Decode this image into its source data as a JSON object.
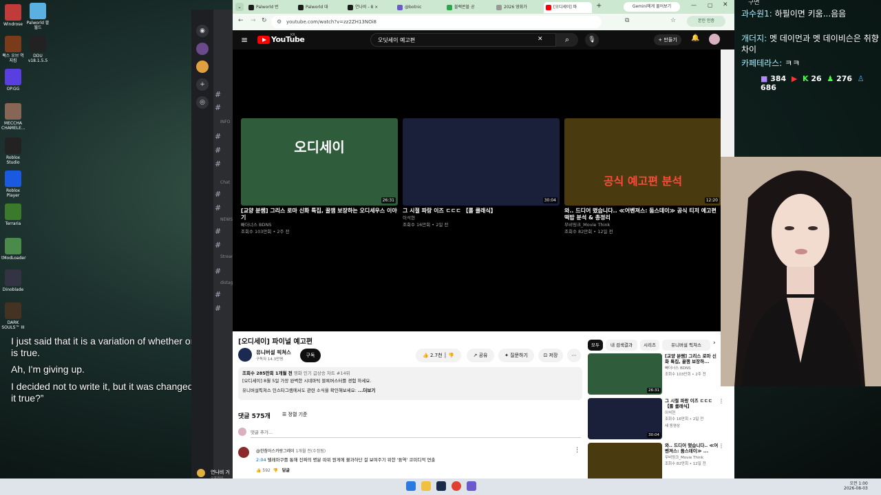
{
  "desktop": {
    "icons": [
      {
        "label": "Windrose",
        "color": "#c23b3b"
      },
      {
        "label": "Palworld 팔월드",
        "color": "#5ab0e0"
      },
      {
        "label": "팩스 오브 역지킴",
        "color": "#7a3b1a"
      },
      {
        "label": "DDU v18.1.5.5",
        "color": "#222"
      },
      {
        "label": "OP.GG",
        "color": "#5a3fe0"
      },
      {
        "label": "MECCHA CHAMELE...",
        "color": "#886655"
      },
      {
        "label": "Roblox Studio",
        "color": "#222"
      },
      {
        "label": "Roblox Player",
        "color": "#1a5ae0"
      },
      {
        "label": "Terraria",
        "color": "#3a7a2a"
      },
      {
        "label": "tModLoader",
        "color": "#4a8a4a"
      },
      {
        "label": "Dinoblade",
        "color": "#334"
      },
      {
        "label": "DARK SOULS™ III",
        "color": "#443322"
      }
    ]
  },
  "subtitles": [
    "I just said that it is a variation of whether or not it is true.",
    "Ah, I'm giving up.",
    "I decided not to write it, but it was changed to “Is it true?”"
  ],
  "discord": {
    "labels": {
      "info": "INFO",
      "chat": "Chat",
      "news": "NEWS",
      "stream": "Stream",
      "distag": "distag"
    },
    "bottom_user": "연나비 거",
    "bottom_sub": "오프라인"
  },
  "browser": {
    "tabs": [
      {
        "label": "Palworld 번",
        "fav": "#1a1a1a"
      },
      {
        "label": "Palworld 대",
        "fav": "#1a1a1a"
      },
      {
        "label": "연나비 - 8 ×",
        "fav": "#1a1a1a"
      },
      {
        "label": "@botnic",
        "fav": "#6a5acd"
      },
      {
        "label": "블랙몬블 공",
        "fav": "#2aa84a"
      },
      {
        "label": "2026 영화가",
        "fav": "#999"
      },
      {
        "label": "[오디세이] 파",
        "fav": "#ff0000"
      }
    ],
    "gemini_tab": "Gemini에게 물어보기",
    "url": "youtube.com/watch?v=zz2ZH13NOi8",
    "profile_chip": "본인 인증"
  },
  "youtube": {
    "logo": "YouTube",
    "logo_region": "KR",
    "search_value": "오딧세이 예고편",
    "create_label": "만들기",
    "endscreen": [
      {
        "title": "[교양 분쌤] 그리스 로마 신화 특집, 꿀잼 보장하는 오디세우스 이야기",
        "channel": "빠더너스 BDNS",
        "meta": "조회수 103만회 • 2주 전",
        "duration": "26:31",
        "thumb_text": "오디세이",
        "bg": "#2f5d3c"
      },
      {
        "title": "그 시절 파랑 이즈 ㄷㄷㄷ 【롤 클래식】",
        "channel": "이석현",
        "meta": "조회수 16만회 • 2일 전",
        "duration": "30:04",
        "thumb_text": "",
        "bg": "#1a1f3a"
      },
      {
        "title": "와.. 드디어 떴습니다.. ≪어벤져스: 둠스데이≫ 공식 티저 예고편 떡밥 분석 & 총정리",
        "channel": "무비띵크_Movie Think",
        "meta": "조회수 82만회 • 12일 전",
        "duration": "12:20",
        "thumb_text": "공식 예고편 분석",
        "bg": "#4a3a10"
      }
    ],
    "video_title": "[오디세이] 파이널 예고편",
    "channel_name": "유니버설 픽쳐스",
    "subscribers": "구독자 14.3만명",
    "subscribe_label": "구독",
    "actions": {
      "likes": "2.7천",
      "share": "공유",
      "ask": "질문하기",
      "save": "저장"
    },
    "description": {
      "line1_bold": "조회수 285만회  1개월 전",
      "line1_rest": "영화 인기 급상승 차트 #14위",
      "line2": "[오디세이] 8월 5일 가장 완벽한 시네마틱 블록버스터를 경험 하세요.",
      "line3": "유니버설픽쳐스 인스타그램에서도 관련 소식을 확인해보세요:",
      "more": "...더보기"
    },
    "comments": {
      "count": "댓글 575개",
      "sort": "정렬 기준",
      "add_placeholder": "댓글 추가...",
      "first": {
        "author": "@한참아스카랑그레이",
        "time": "1개월 전(수정됨)",
        "timestamp": "2:04",
        "text": "텔레마쿠를 통해 진짜의 명분 따위 뭔게에 불과하단 걸 보여주기 위한 '듕역' 코미디적 연출",
        "likes": "592",
        "reply": "답글"
      }
    },
    "chips": [
      "모두",
      "내 검색결과",
      "시리즈",
      "유니버설 픽쳐스"
    ],
    "recommendations": [
      {
        "title": "[교양 분쌤] 그리스 로마 신화 특집, 꿀잼 보장하...",
        "channel": "빠더너스 BDNS",
        "meta": "조회수 103만회 • 2주 전",
        "duration": "26:31",
        "bg": "#2f5d3c"
      },
      {
        "title": "그 시절 파랑 이즈 ㄷㄷㄷ 【롤 클래식】",
        "channel": "이석현",
        "meta": "조회수 16만회 • 2일 전",
        "extra": "새 동영상",
        "duration": "30:04",
        "bg": "#1a1f3a"
      },
      {
        "title": "와.. 드디어 떴습니다.. ≪어벤져스: 둠스데이≫ ...",
        "channel": "무비띵크_Movie Think",
        "meta": "조회수 82만회 • 12일 전",
        "duration": "",
        "bg": "#4a3a10"
      }
    ]
  },
  "chat": {
    "top": "구면",
    "lines": [
      {
        "name": "과수원1:",
        "text": "하필이면 키움...음음"
      },
      {
        "name": "개더지:",
        "text": "멧 데이먼과 멧 데이비슨은 취향차이"
      },
      {
        "name": "카페테라스:",
        "text": "ㅋㅋ"
      }
    ],
    "stats": [
      "384",
      "26",
      "276",
      "686"
    ]
  },
  "taskbar": {
    "time": "오전 1:00",
    "date": "2026-08-03"
  }
}
